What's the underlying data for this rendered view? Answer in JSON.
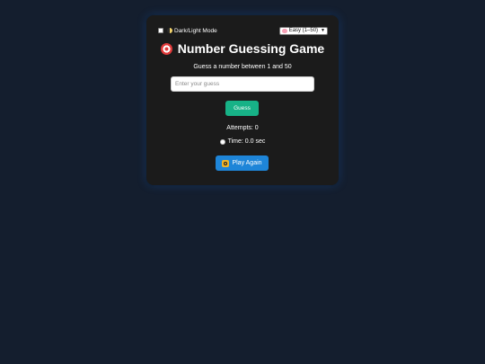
{
  "mode_toggle": {
    "label": "Dark/Light Mode",
    "icon": "moon-icon",
    "checked": false
  },
  "difficulty": {
    "selected": "Easy (1–50)",
    "icon": "brain-icon"
  },
  "title": {
    "text": "Number Guessing Game",
    "icon": "target-icon"
  },
  "subtitle": "Guess a number between 1 and 50",
  "guess_input": {
    "placeholder": "Enter your guess",
    "value": ""
  },
  "guess_button": {
    "label": "Guess"
  },
  "stats": {
    "attempts": "Attempts: 0",
    "time": "Time: 0.0 sec",
    "time_icon": "stopwatch-icon"
  },
  "play_again": {
    "label": "Play Again",
    "icon": "refresh-icon"
  },
  "colors": {
    "page_background": "#141e2e",
    "card_background": "#1b1b1b",
    "guess_button": "#17b287",
    "play_again_button": "#1e85d8"
  }
}
